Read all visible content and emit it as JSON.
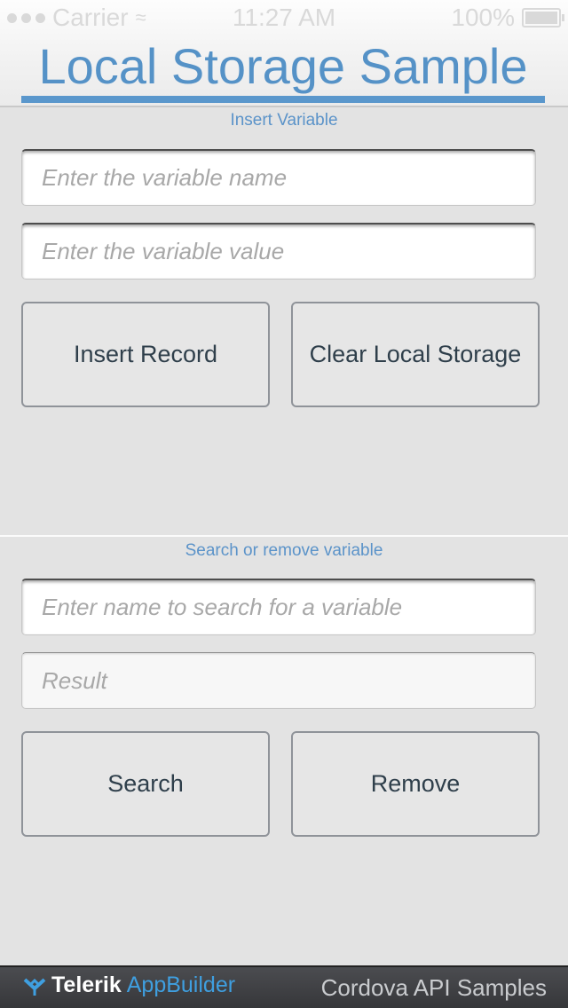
{
  "status_bar": {
    "carrier": "Carrier",
    "time": "11:27 AM",
    "battery": "100%"
  },
  "header": {
    "title": "Local Storage Sample"
  },
  "insert_section": {
    "label": "Insert Variable",
    "name_placeholder": "Enter the variable name",
    "value_placeholder": "Enter the variable value",
    "insert_button": "Insert Record",
    "clear_button": "Clear Local Storage"
  },
  "search_section": {
    "label": "Search or remove variable",
    "search_placeholder": "Enter name to search for a variable",
    "result_placeholder": "Result",
    "search_button": "Search",
    "remove_button": "Remove"
  },
  "footer": {
    "brand_primary": "Telerik",
    "brand_secondary": "AppBuilder",
    "caption": "Cordova API Samples"
  },
  "colors": {
    "accent": "#5592c7",
    "background": "#e3e3e3",
    "footer": "#3f4044",
    "brand_blue": "#3f9fe0"
  }
}
